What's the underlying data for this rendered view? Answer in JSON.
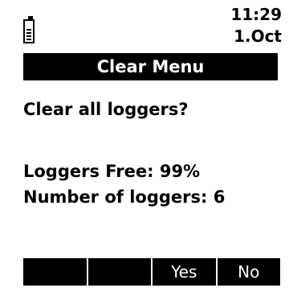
{
  "status": {
    "time": "11:29",
    "date": "1.Oct",
    "battery_icon": "battery-icon"
  },
  "header": {
    "title": "Clear Menu"
  },
  "main": {
    "question": "Clear all loggers?",
    "loggers_free": "Loggers Free: 99%",
    "number_of_loggers": "Number of loggers: 6"
  },
  "softkeys": [
    "",
    "",
    "Yes",
    "No"
  ]
}
